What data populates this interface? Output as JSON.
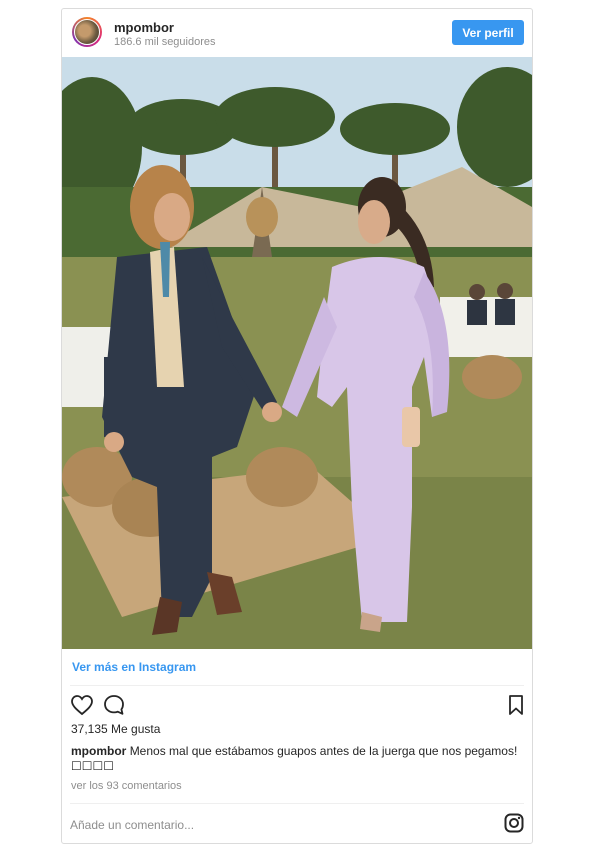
{
  "header": {
    "username": "mpombor",
    "followers": "186.6 mil seguidores",
    "profile_button": "Ver perfil"
  },
  "photo": {
    "alt": "couple-walking-at-garden-event"
  },
  "links": {
    "view_more": "Ver más en Instagram"
  },
  "actions": {
    "like_icon": "heart-icon",
    "comment_icon": "comment-bubble-icon",
    "save_icon": "bookmark-icon"
  },
  "stats": {
    "likes": "37,135 Me gusta"
  },
  "caption": {
    "username": "mpombor",
    "text": "Menos mal que estábamos guapos antes de la juerga que nos pegamos! ☐☐☐☐"
  },
  "comments": {
    "view_all": "ver los 93 comentarios"
  },
  "comment_box": {
    "placeholder": "Añade un comentario..."
  },
  "footer": {
    "logo_icon": "instagram-logo-icon"
  },
  "colors": {
    "accent": "#3897f0",
    "text": "#262626",
    "muted": "#8e8e8e",
    "border": "#dbdbdb"
  }
}
